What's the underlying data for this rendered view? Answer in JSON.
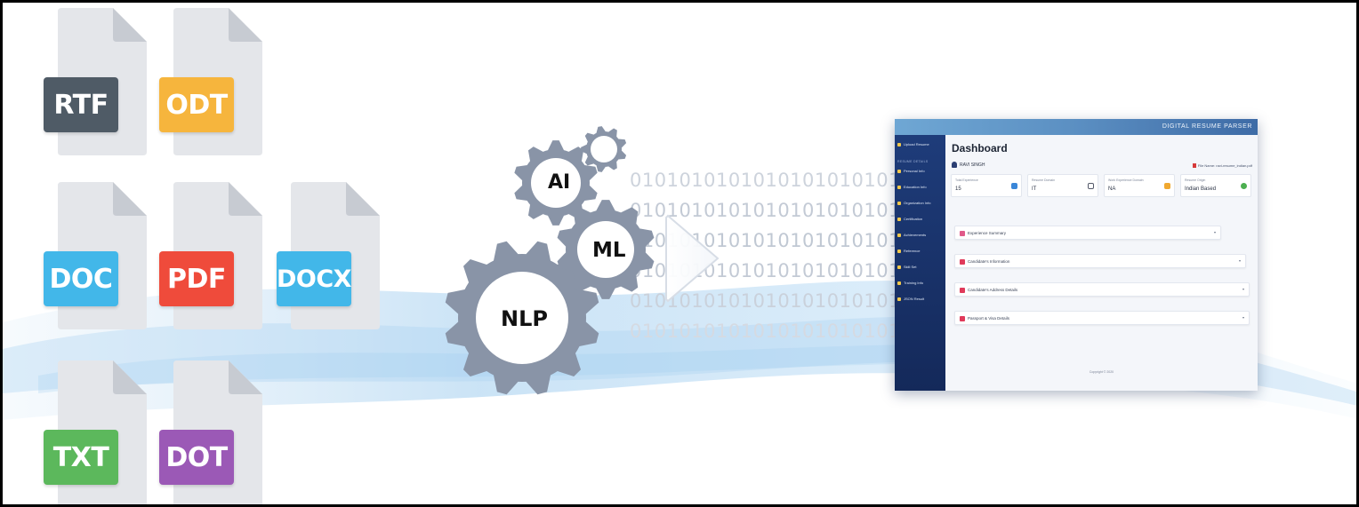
{
  "files": [
    {
      "label": "RTF",
      "color": "#4f5b66"
    },
    {
      "label": "ODT",
      "color": "#f6b53d"
    },
    {
      "label": "DOC",
      "color": "#42b7e9"
    },
    {
      "label": "PDF",
      "color": "#ef4b3b"
    },
    {
      "label": "DOCX",
      "color": "#42b7e9"
    },
    {
      "label": "TXT",
      "color": "#5cb85c"
    },
    {
      "label": "DOT",
      "color": "#9b59b6"
    }
  ],
  "gears": {
    "ai": "AI",
    "ml": "ML",
    "nlp": "NLP",
    "color": "#8994a7"
  },
  "binary": {
    "text": "01010101010101010101010101010101010101"
  },
  "dashboard": {
    "app_name": "",
    "header_title": "DIGITAL RESUME PARSER",
    "upload_label": "Upload Resume",
    "section_label": "RESUME DETAILS",
    "sidebar_items": [
      "Personal Info",
      "Education Info",
      "Organization Info",
      "Certification",
      "Achievements",
      "Reference",
      "Skill Set",
      "Training Info",
      "JSON Result"
    ],
    "page_title": "Dashboard",
    "user_name": "RAVI SINGH",
    "file_name": "File Name: ravi-resume_indian.pdf",
    "stats": [
      {
        "label": "Total Experience",
        "value": "15"
      },
      {
        "label": "Resume Domain",
        "value": "IT"
      },
      {
        "label": "Work Experience Domain",
        "value": "NA"
      },
      {
        "label": "Resume Origin",
        "value": "Indian Based"
      }
    ],
    "sections": [
      "Experience Summary",
      "Candidate's Information",
      "Candidate's Address Details",
      "Passport & Visa Details"
    ],
    "copyright": "Copyright © 2020"
  }
}
